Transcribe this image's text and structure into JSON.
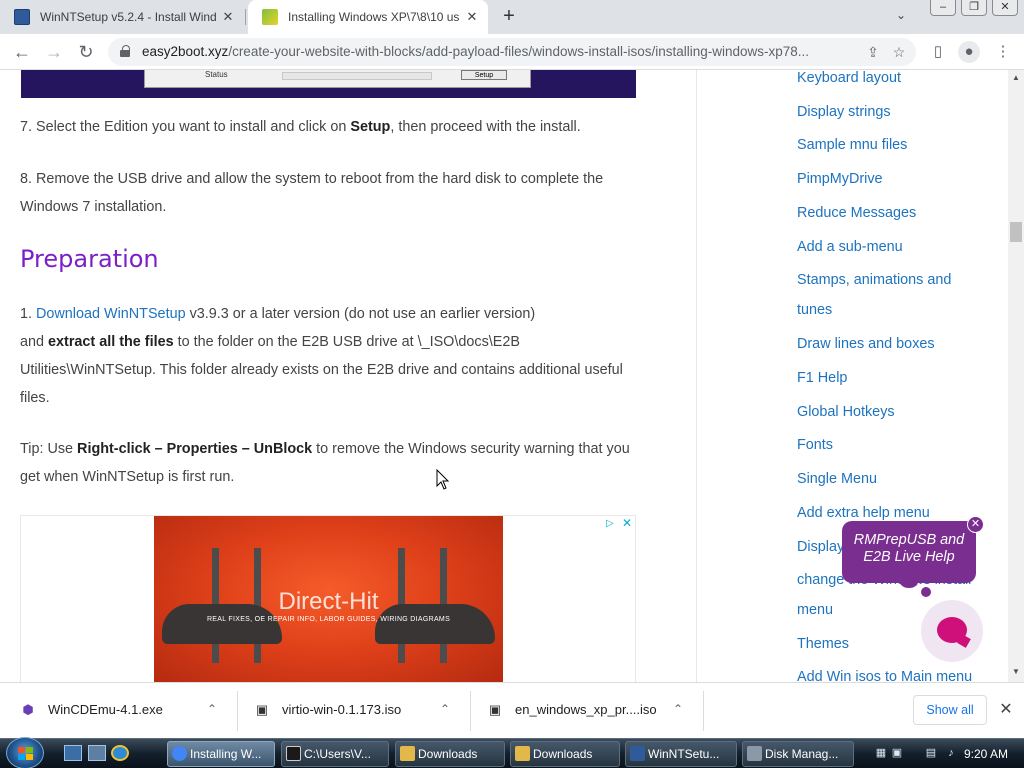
{
  "browser": {
    "tabs": [
      {
        "title": "WinNTSetup v5.2.4 - Install Wind",
        "active": false
      },
      {
        "title": "Installing Windows XP\\7\\8\\10 us",
        "active": true
      }
    ],
    "new_tab_symbol": "+",
    "url_host": "easy2boot.xyz",
    "url_path": "/create-your-website-with-blocks/add-payload-files/windows-install-isos/installing-windows-xp78..."
  },
  "article": {
    "hero_status": "Status",
    "hero_setup": "Setup",
    "step7": {
      "pre": "7. Select the Edition you want to install and click on ",
      "bold": "Setup",
      "post": ", then proceed with the install."
    },
    "step8": "8. Remove the USB drive and allow the system to reboot from the hard disk to complete the Windows 7 installation.",
    "heading": "Preparation",
    "prep": {
      "p1": " 1. ",
      "link": "Download WinNTSetup",
      "p2": "  v3.9.3 or a later version  (do not use an earlier version)",
      "p3": "and ",
      "bold": "extract all the files",
      "p4": " to the folder on the E2B USB drive at  \\_ISO\\docs\\E2B Utilities\\WinNTSetup. This folder already exists on the E2B drive and contains additional useful files."
    },
    "tip": {
      "pre": "Tip: Use ",
      "bold": "Right-click – Properties – UnBlock",
      "post": " to remove the Windows security warning that you get when WinNTSetup is first run."
    },
    "ad": {
      "brand": "Direct-Hit",
      "tagline": "REAL FIXES, OE REPAIR INFO, LABOR GUIDES, WIRING DIAGRAMS"
    }
  },
  "sidebar": {
    "links": [
      "Keyboard layout",
      "Display strings",
      "Sample mnu files",
      "PimpMyDrive",
      "Reduce Messages",
      "Add a sub-menu",
      "Stamps, animations and tunes",
      "Draw lines and boxes",
      "F1 Help",
      "Global Hotkeys",
      "Fonts",
      "Single Menu",
      "Add extra help menu",
      "Display",
      "change the Windows install menu",
      "Themes",
      "Add Win isos to Main menu"
    ]
  },
  "live_help": {
    "text": "RMPrepUSB and E2B Live Help"
  },
  "downloads": {
    "items": [
      {
        "name": "WinCDEmu-4.1.exe"
      },
      {
        "name": "virtio-win-0.1.173.iso"
      },
      {
        "name": "en_windows_xp_pr....iso"
      }
    ],
    "show_all": "Show all"
  },
  "taskbar": {
    "buttons": [
      {
        "label": "Installing W...",
        "active": true
      },
      {
        "label": "C:\\Users\\V...",
        "active": false
      },
      {
        "label": "Downloads",
        "active": false
      },
      {
        "label": "Downloads",
        "active": false
      },
      {
        "label": "WinNTSetu...",
        "active": false
      },
      {
        "label": "Disk Manag...",
        "active": false
      }
    ],
    "clock": "9:20 AM"
  },
  "icons": {
    "back": "arrow-left-icon",
    "forward": "arrow-right-icon",
    "reload": "reload-icon",
    "lock": "lock-icon",
    "share": "share-icon",
    "bookmark": "star-icon",
    "sidepanel": "side-panel-icon",
    "profile": "profile-icon",
    "menu": "kebab-menu-icon"
  },
  "colors": {
    "link": "#1e73be",
    "heading": "#7b1fc8",
    "live_help": "#7a2e8f",
    "chat": "#d0107a"
  }
}
